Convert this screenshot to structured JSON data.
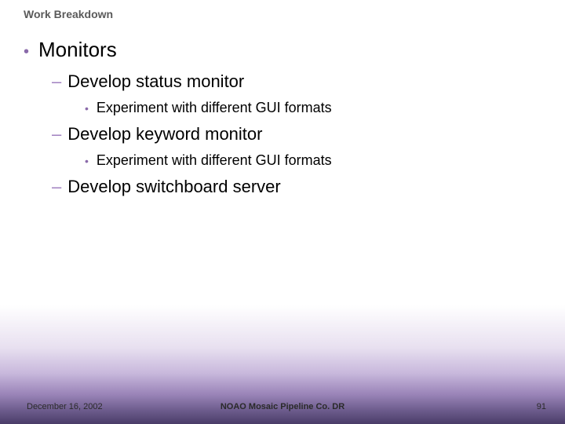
{
  "title": "Work Breakdown",
  "l1_label": "Monitors",
  "items": [
    {
      "label": "Develop status monitor",
      "sub": "Experiment with different GUI formats"
    },
    {
      "label": "Develop keyword monitor",
      "sub": "Experiment with different GUI formats"
    },
    {
      "label": "Develop switchboard server",
      "sub": null
    }
  ],
  "footer": {
    "date": "December 16, 2002",
    "center": "NOAO Mosaic Pipeline Co. DR",
    "page": "91"
  }
}
